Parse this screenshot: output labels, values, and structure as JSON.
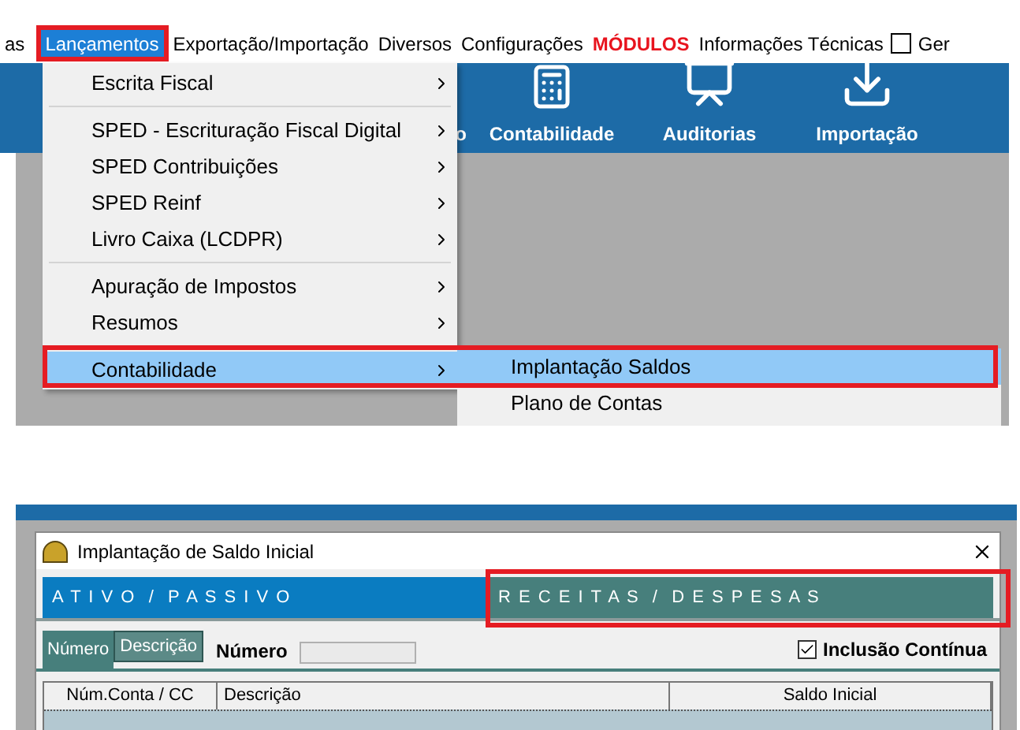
{
  "menu_bar": {
    "items": [
      {
        "label": "as",
        "kind": "menu",
        "selected": false
      },
      {
        "label": "Lançamentos",
        "kind": "menu",
        "selected": true
      },
      {
        "label": "Exportação/Importação",
        "kind": "menu",
        "selected": false
      },
      {
        "label": "Diversos",
        "kind": "menu",
        "selected": false
      },
      {
        "label": "Configurações",
        "kind": "menu",
        "selected": false
      },
      {
        "label": "MÓDULOS",
        "kind": "alert",
        "selected": false
      },
      {
        "label": "Informações Técnicas",
        "kind": "menu",
        "selected": false
      },
      {
        "label": "Ger",
        "kind": "checkbox",
        "checked": false
      }
    ]
  },
  "toolbar": {
    "buttons": [
      {
        "label": "o",
        "kind": "hidden"
      },
      {
        "label": "Contabilidade",
        "kind": "calculator"
      },
      {
        "label": "Auditorias",
        "kind": "chart"
      },
      {
        "label": "Importação",
        "kind": "download"
      }
    ]
  },
  "dropdown": {
    "groups": [
      [
        {
          "label": "Escrita Fiscal",
          "submenu": true,
          "selected": false
        }
      ],
      [
        {
          "label": "SPED - Escrituração Fiscal Digital",
          "submenu": true,
          "selected": false
        },
        {
          "label": "SPED Contribuições",
          "submenu": true,
          "selected": false
        },
        {
          "label": "SPED Reinf",
          "submenu": true,
          "selected": false
        },
        {
          "label": "Livro Caixa (LCDPR)",
          "submenu": true,
          "selected": false
        }
      ],
      [
        {
          "label": "Apuração de Impostos",
          "submenu": true,
          "selected": false
        },
        {
          "label": "Resumos",
          "submenu": true,
          "selected": false
        }
      ],
      [
        {
          "label": "Contabilidade",
          "submenu": true,
          "selected": true
        }
      ]
    ]
  },
  "submenu": {
    "items": [
      {
        "label": "Implantação Saldos",
        "selected": true
      },
      {
        "label": "Plano de Contas",
        "selected": false
      }
    ]
  },
  "dialog": {
    "title": "Implantação de Saldo Inicial",
    "tabs": [
      {
        "label": "A T I V O  /  P A S S I V O",
        "selected": true
      },
      {
        "label": "R E C E I T A S  /  D E S P E S A S",
        "selected": false
      }
    ],
    "search_tabs": [
      {
        "label": "Número",
        "selected": true
      },
      {
        "label": "Descrição",
        "selected": false
      }
    ],
    "search_label": "Número",
    "continuous": {
      "label": "Inclusão Contínua",
      "checked": true
    },
    "table": {
      "columns": [
        "Núm.Conta / CC",
        "Descrição",
        "Saldo Inicial"
      ]
    }
  }
}
